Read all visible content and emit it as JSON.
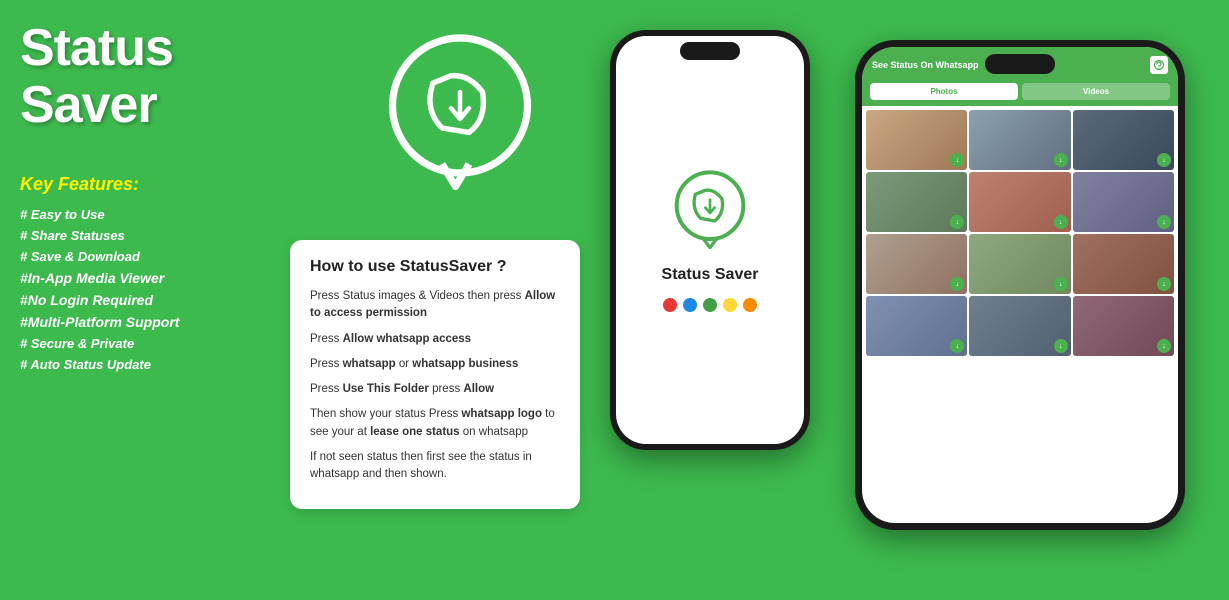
{
  "app": {
    "title": "Status Saver",
    "bg_color": "#3dba4e"
  },
  "left": {
    "title": "Status Saver",
    "key_features_label": "Key Features:",
    "features": [
      "# Easy to Use",
      "# Share Statuses",
      "# Save & Download",
      "#In-App Media Viewer",
      "#No Login Required",
      "#Multi-Platform Support",
      "# Secure & Private",
      "# Auto Status Update"
    ]
  },
  "how_to": {
    "title": "How to use StatusSaver ?",
    "steps": [
      "Press Status images & Videos then press Allow to access permission",
      "Press Allow whatsapp access",
      "Press whatsapp or  whatsapp business",
      "Press Use This Folder  press Allow",
      "Then show your status Press whatsapp logo to see your at lease one status on whatsapp",
      "If not seen status then first see the status in whatsapp and then shown."
    ],
    "bold_parts": {
      "step1_bold": "Allow to access permission",
      "step2_bold": "Allow whatsapp access",
      "step3_bold": "whatsapp",
      "step3_bold2": "whatsapp business",
      "step4_bold": "Use This Folder",
      "step4_bold2": "Allow",
      "step5_bold": "whatsapp logo",
      "step5_bold2": "lease one status"
    }
  },
  "phone_center": {
    "app_name": "Status Saver",
    "dots": [
      {
        "color": "#e53935"
      },
      {
        "color": "#1e88e5"
      },
      {
        "color": "#43a047"
      },
      {
        "color": "#fdd835"
      },
      {
        "color": "#fb8c00"
      }
    ]
  },
  "phone_right": {
    "header_title": "See Status On Whatsapp",
    "tab_photos": "Photos",
    "tab_videos": "Videos"
  },
  "gallery_colors": [
    "#c8a882",
    "#8ca0b0",
    "#5a6a7a",
    "#7a9a7a",
    "#c08070",
    "#8080a0",
    "#b0a090",
    "#90a880",
    "#a07060",
    "#8090b0",
    "#708090",
    "#906878"
  ]
}
